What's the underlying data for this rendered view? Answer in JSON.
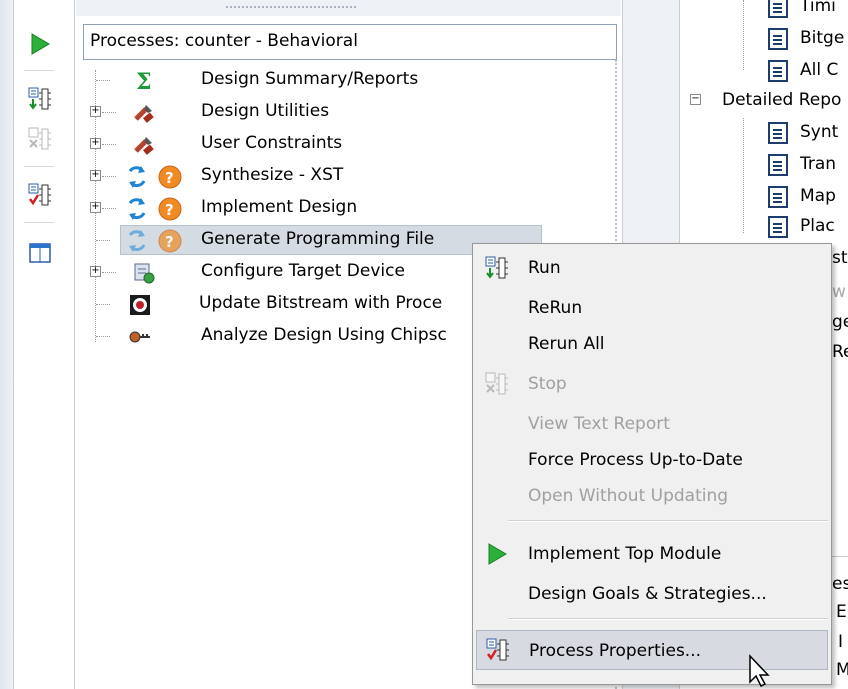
{
  "processes_panel": {
    "title": "Processes: counter - Behavioral",
    "items": [
      {
        "label": "Design Summary/Reports",
        "icon": "sigma-icon",
        "expandable": false
      },
      {
        "label": "Design Utilities",
        "icon": "tools-icon",
        "expandable": true
      },
      {
        "label": "User Constraints",
        "icon": "tools-icon",
        "expandable": true
      },
      {
        "label": "Synthesize - XST",
        "icon": "refresh-question-icon",
        "expandable": true
      },
      {
        "label": "Implement Design",
        "icon": "refresh-question-icon",
        "expandable": true
      },
      {
        "label": "Generate Programming File",
        "icon": "refresh-question-icon",
        "expandable": false,
        "selected": true
      },
      {
        "label": "Configure Target Device",
        "icon": "device-icon",
        "expandable": true
      },
      {
        "label": "Update Bitstream with Proce",
        "icon": "chip-icon",
        "expandable": false
      },
      {
        "label": "Analyze Design Using Chipsc",
        "icon": "probe-icon",
        "expandable": false
      }
    ]
  },
  "toolbar": {
    "buttons": [
      "run-icon",
      "rerun-icon",
      "stop-icon",
      "properties-icon",
      "window-icon"
    ]
  },
  "right_panel": {
    "rows": [
      {
        "label": "Timi",
        "indent": 2
      },
      {
        "label": "Bitge",
        "indent": 2
      },
      {
        "label": "All C",
        "indent": 2
      },
      {
        "label": "Detailed Repo",
        "indent": 1
      },
      {
        "label": "Synt",
        "indent": 2
      },
      {
        "label": "Tran",
        "indent": 2
      },
      {
        "label": "Map",
        "indent": 2
      },
      {
        "label": "Plac",
        "indent": 2
      },
      {
        "label": "st",
        "indent": 3
      },
      {
        "label": "w",
        "indent": 3
      },
      {
        "label": "ge",
        "indent": 3
      },
      {
        "label": "Re",
        "indent": 3
      },
      {
        "label": "es",
        "indent": 3
      },
      {
        "label": "E",
        "indent": 3
      },
      {
        "label": "I",
        "indent": 3
      },
      {
        "label": "M",
        "indent": 3
      }
    ]
  },
  "context_menu": {
    "items": [
      {
        "label": "Run",
        "enabled": true,
        "icon": "run-icon"
      },
      {
        "label": "ReRun",
        "enabled": true
      },
      {
        "label": "Rerun All",
        "enabled": true
      },
      {
        "label": "Stop",
        "enabled": false,
        "icon": "stop-icon"
      },
      {
        "label": "View Text Report",
        "enabled": false
      },
      {
        "label": "Force Process Up-to-Date",
        "enabled": true
      },
      {
        "label": "Open Without Updating",
        "enabled": false
      },
      {
        "label": "Implement Top Module",
        "enabled": true,
        "icon": "play-icon"
      },
      {
        "label": "Design Goals & Strategies...",
        "enabled": true
      },
      {
        "label": "Process Properties...",
        "enabled": true,
        "icon": "properties-icon",
        "hovered": true
      }
    ]
  },
  "colors": {
    "accent_green": "#2db03a",
    "question_orange": "#f08a24",
    "refresh_blue": "#1f86d6",
    "menu_bg": "#f0f0f0",
    "disabled_text": "#a0a0a0"
  }
}
